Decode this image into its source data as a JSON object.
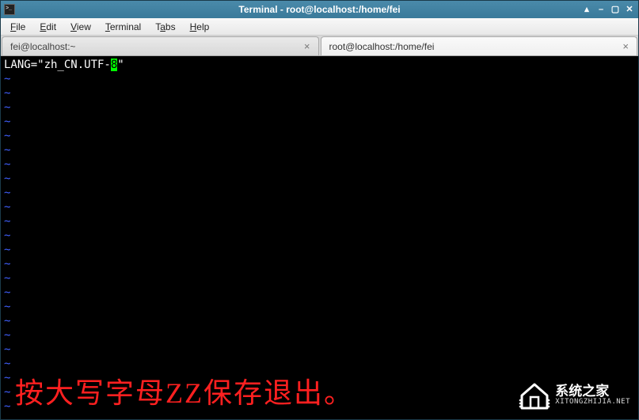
{
  "window": {
    "title": "Terminal - root@localhost:/home/fei"
  },
  "menubar": {
    "items": [
      "File",
      "Edit",
      "View",
      "Terminal",
      "Tabs",
      "Help"
    ]
  },
  "tabs": [
    {
      "label": "fei@localhost:~",
      "active": false
    },
    {
      "label": "root@localhost:/home/fei",
      "active": true
    }
  ],
  "terminal": {
    "line_prefix": "LANG=\"zh_CN.UTF-",
    "cursor_char": "8",
    "line_suffix": "\"",
    "tilde_rows": 24
  },
  "overlay": {
    "text": "按大写字母ZZ保存退出。"
  },
  "watermark": {
    "cn": "系统之家",
    "en": "XITONGZHIJIA.NET"
  }
}
